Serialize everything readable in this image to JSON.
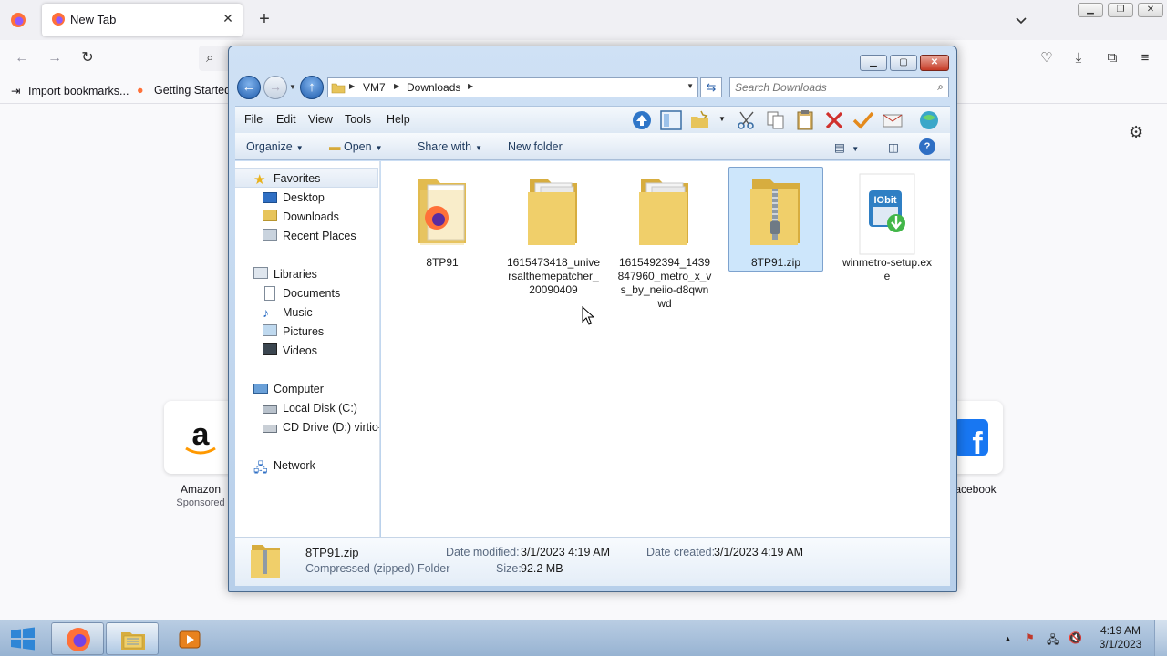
{
  "browser": {
    "tab": {
      "title": "New Tab"
    },
    "bookmarks": [
      {
        "label": "Import bookmarks..."
      },
      {
        "label": "Getting Started"
      }
    ],
    "shortcuts": [
      {
        "label": "Amazon",
        "sublabel": "Sponsored"
      },
      {
        "label": "acebook"
      }
    ]
  },
  "explorer": {
    "breadcrumb": [
      "VM7",
      "Downloads"
    ],
    "search_placeholder": "Search Downloads",
    "menu": [
      "File",
      "Edit",
      "View",
      "Tools",
      "Help"
    ],
    "commands": {
      "organize": "Organize",
      "open": "Open",
      "share": "Share with",
      "new_folder": "New folder"
    },
    "nav": {
      "favorites": "Favorites",
      "favorites_items": [
        "Desktop",
        "Downloads",
        "Recent Places"
      ],
      "libraries": "Libraries",
      "libraries_items": [
        "Documents",
        "Music",
        "Pictures",
        "Videos"
      ],
      "computer": "Computer",
      "computer_items": [
        "Local Disk (C:)",
        "CD Drive (D:) virtio-w"
      ],
      "network": "Network"
    },
    "files": [
      {
        "name": "8TP91",
        "icon": "firefox-folder-icon"
      },
      {
        "name": "1615473418_universalthemepatcher_20090409",
        "icon": "folder-icon"
      },
      {
        "name": "1615492394_1439847960_metro_x_vs_by_neiio-d8qwnwd",
        "icon": "folder-icon"
      },
      {
        "name": "8TP91.zip",
        "icon": "zip-folder-icon",
        "selected": true
      },
      {
        "name": "winmetro-setup.exe",
        "icon": "iobit-installer-icon"
      }
    ],
    "details": {
      "name": "8TP91.zip",
      "type": "Compressed (zipped) Folder",
      "modified_label": "Date modified:",
      "modified": "3/1/2023 4:19 AM",
      "created_label": "Date created:",
      "created": "3/1/2023 4:19 AM",
      "size_label": "Size:",
      "size": "92.2 MB"
    }
  },
  "taskbar": {
    "time": "4:19 AM",
    "date": "3/1/2023"
  },
  "colors": {
    "explorer_frame": "#b7cfea",
    "selection": "#cde6fb",
    "taskbar": "#a8c0dc"
  }
}
